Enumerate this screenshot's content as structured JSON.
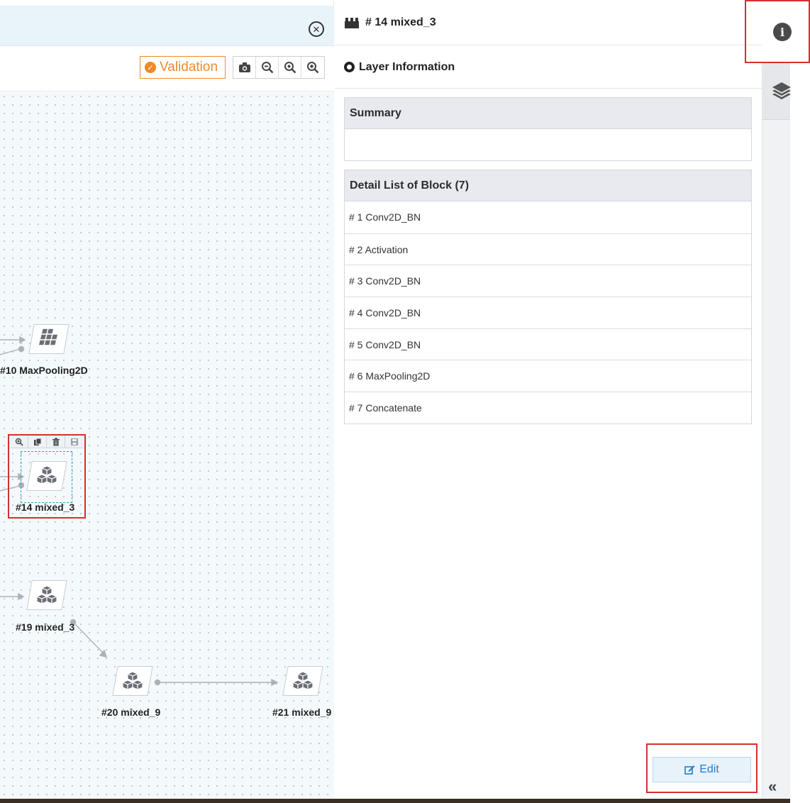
{
  "toolbar": {
    "validation_label": "Validation",
    "tools": [
      "camera-icon",
      "zoom-out-icon",
      "zoom-fit-icon",
      "zoom-in-icon"
    ]
  },
  "canvas": {
    "nodes": [
      {
        "id": "n10",
        "label": "#10 MaxPooling2D",
        "icon": "grid-icon"
      },
      {
        "id": "n14",
        "label": "#14 mixed_3",
        "icon": "cubes-icon",
        "selected": true
      },
      {
        "id": "n19",
        "label": "#19 mixed_3",
        "icon": "cubes-icon"
      },
      {
        "id": "n20",
        "label": "#20 mixed_9",
        "icon": "cubes-icon"
      },
      {
        "id": "n21",
        "label": "#21 mixed_9",
        "icon": "cubes-icon"
      }
    ],
    "selection_tools": [
      "zoom-icon",
      "copy-icon",
      "delete-icon",
      "save-icon"
    ]
  },
  "panel": {
    "header_title": "# 14 mixed_3",
    "layer_info_label": "Layer Information",
    "summary_title": "Summary",
    "summary_text": "",
    "detail_title": "Detail List of Block (7)",
    "details": [
      "# 1 Conv2D_BN",
      "# 2 Activation",
      "# 3 Conv2D_BN",
      "# 4 Conv2D_BN",
      "# 5 Conv2D_BN",
      "# 6 MaxPooling2D",
      "# 7 Concatenate"
    ],
    "edit_label": "Edit"
  },
  "sidebar": {
    "info_icon": "info-icon",
    "layers_icon": "layers-icon",
    "collapse_icon": "double-chevron-left-icon"
  },
  "colors": {
    "accent_orange": "#f08a24",
    "highlight_red": "#d62f2f",
    "edit_blue": "#2b7cc1",
    "topbar_blue": "#e8f4fa"
  }
}
